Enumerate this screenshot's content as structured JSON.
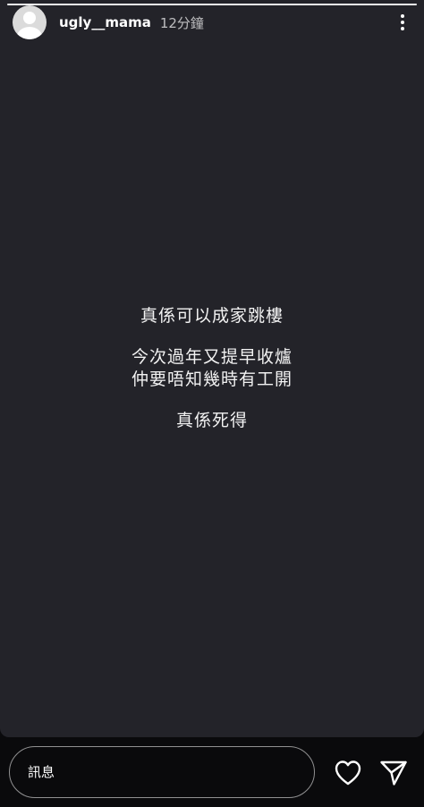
{
  "story": {
    "username": "ugly__mama",
    "timestamp": "12分鐘",
    "progress": 1.0,
    "text_lines": [
      "真係可以成家跳樓",
      "今次過年又提早收爐",
      "仲要唔知幾時有工開",
      "真係死得"
    ]
  },
  "reply": {
    "placeholder": "訊息"
  },
  "icons": {
    "more": "more-vertical-icon",
    "like": "heart-icon",
    "share": "send-icon"
  },
  "colors": {
    "story_background": "#232329",
    "bar_background": "#0a0a0c",
    "text": "#ffffff"
  }
}
